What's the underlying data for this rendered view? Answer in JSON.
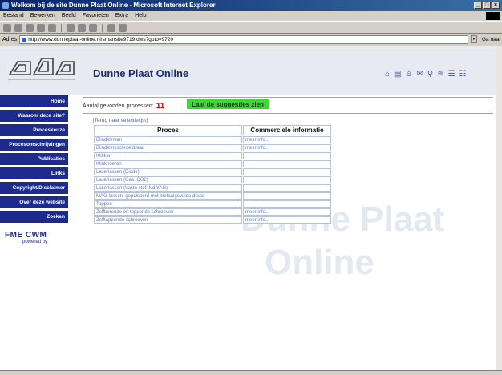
{
  "window": {
    "title": "Welkom bij de site Dunne Plaat Online - Microsoft Internet Explorer"
  },
  "menu": [
    "Bestand",
    "Bewerken",
    "Beeld",
    "Favorieten",
    "Extra",
    "Help"
  ],
  "address": {
    "label": "Adres",
    "url": "http://www.dunneplaat-online.nl/smartsite9719.dws?goto=9720",
    "go_label": "Ga naar"
  },
  "site": {
    "title": "Dunne Plaat Online",
    "watermark_line1": "Dunne Plaat",
    "watermark_line2": "Online"
  },
  "nav_icons": [
    "home-icon",
    "print-icon",
    "person-icon",
    "mail-icon",
    "search-icon",
    "stack-icon",
    "list-icon",
    "menu-icon"
  ],
  "sidebar": {
    "items": [
      {
        "label": "Home"
      },
      {
        "label": "Waarom deze site?"
      },
      {
        "label": "Proceskeuze"
      },
      {
        "label": "Procesomschrijvingen"
      },
      {
        "label": "Publicaties"
      },
      {
        "label": "Links"
      },
      {
        "label": "Copyright/Disclaimer"
      },
      {
        "label": "Over deze website"
      },
      {
        "label": "Zoeken"
      }
    ],
    "powered_logo": "FME CWM",
    "powered_by": "powered by"
  },
  "results": {
    "count_label": "Aantal gevonden processen:",
    "count_value": "11",
    "suggest_button": "Laat de suggesties zien",
    "back_link": "[Terug naar selectielijst]",
    "columns": [
      "Proces",
      "Commerciele informatie"
    ],
    "rows": [
      {
        "proces": "Blindklinken",
        "info": "meer info..."
      },
      {
        "proces": "Blindklinkschroefdraad",
        "info": "meer info..."
      },
      {
        "proces": "Klikken",
        "info": ""
      },
      {
        "proces": "Klinknoeren",
        "info": ""
      },
      {
        "proces": "Laserlassen (Diode)",
        "info": ""
      },
      {
        "proces": "Laserlassen (Gas: CO2)",
        "info": ""
      },
      {
        "proces": "Laserlassen (Vaste stof: Nd:YAG)",
        "info": ""
      },
      {
        "proces": "MAG-lassen, gepulseerd met metaalgevulde draad",
        "info": ""
      },
      {
        "proces": "Tappen",
        "info": ""
      },
      {
        "proces": "Zelfborende en tappende schroeven",
        "info": "meer info..."
      },
      {
        "proces": "Zelftappende schroeven",
        "info": "meer info..."
      }
    ]
  }
}
